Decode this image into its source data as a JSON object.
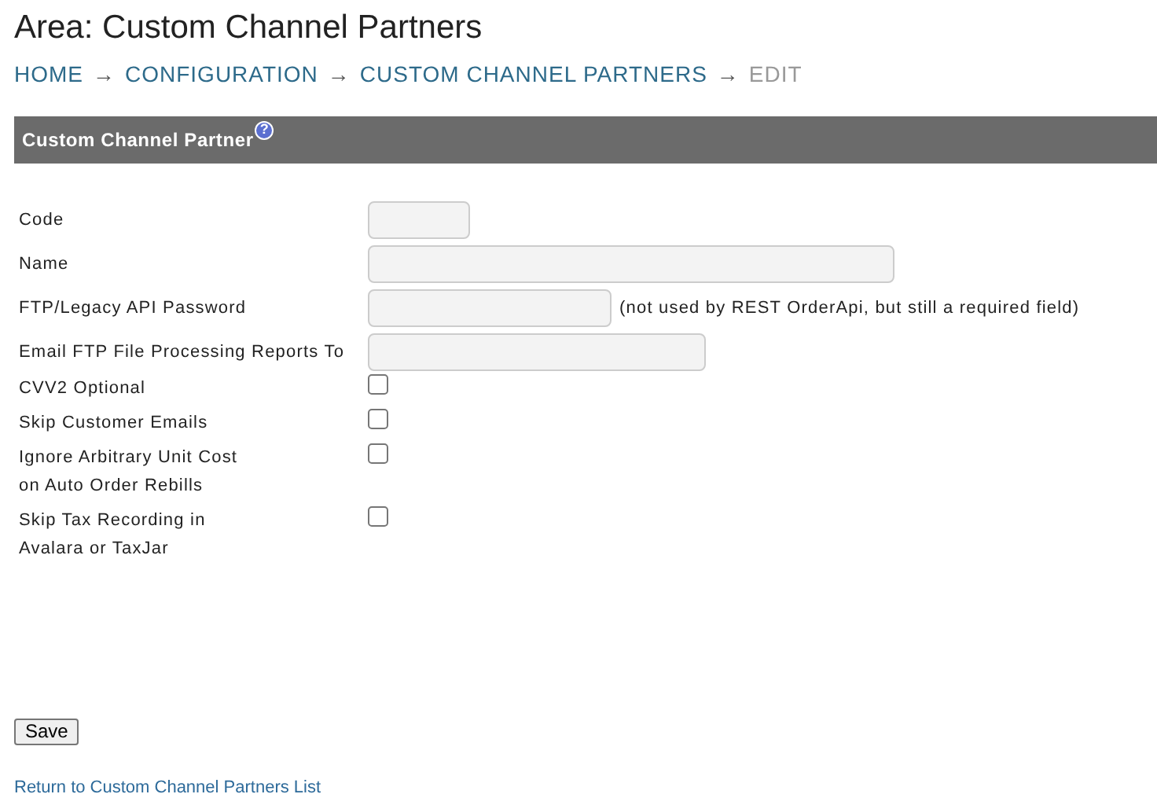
{
  "page_title": "Area: Custom Channel Partners",
  "breadcrumb": [
    {
      "label": "HOME",
      "current": false,
      "arrow": "→"
    },
    {
      "label": "CONFIGURATION",
      "current": false,
      "arrow": "→"
    },
    {
      "label": "CUSTOM CHANNEL PARTNERS",
      "current": false,
      "arrow": "→"
    },
    {
      "label": "EDIT",
      "current": true
    }
  ],
  "panel": {
    "title": "Custom Channel Partner",
    "help": "?"
  },
  "fields": [
    {
      "kind": "text",
      "label": "Code"
    },
    {
      "kind": "text",
      "label": "Name"
    },
    {
      "kind": "text",
      "label": "FTP/Legacy API Password",
      "note": "(not used by REST OrderApi, but still a required field)"
    },
    {
      "kind": "text",
      "label": "Email FTP File Processing Reports To"
    },
    {
      "kind": "checkbox",
      "label": "CVV2 Optional",
      "checked": false
    },
    {
      "kind": "checkbox",
      "label": "Skip Customer Emails",
      "checked": false
    },
    {
      "kind": "checkbox",
      "label": "Ignore Arbitrary Unit Cost on Auto Order Rebills",
      "checked": false
    },
    {
      "kind": "checkbox",
      "label": "Skip Tax Recording in Avalara or TaxJar",
      "checked": false
    }
  ],
  "save_button": "Save",
  "return_link": "Return to Custom Channel Partners List"
}
